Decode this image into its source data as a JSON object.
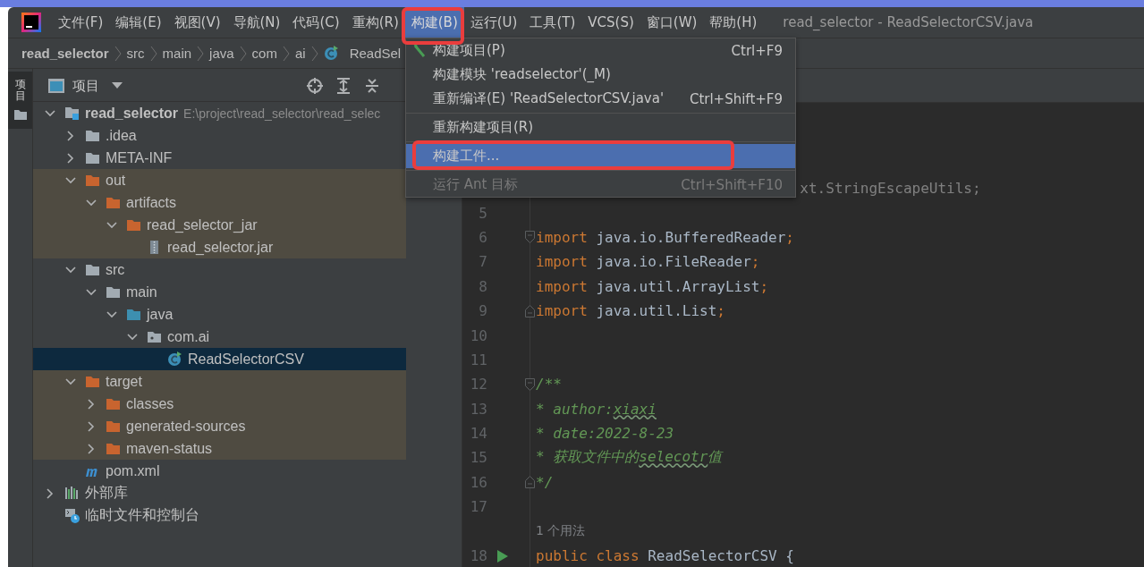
{
  "menubar": {
    "items": [
      {
        "label": "文件(F)",
        "selected": false,
        "annotated": false
      },
      {
        "label": "编辑(E)",
        "selected": false,
        "annotated": false
      },
      {
        "label": "视图(V)",
        "selected": false,
        "annotated": false
      },
      {
        "label": "导航(N)",
        "selected": false,
        "annotated": false
      },
      {
        "label": "代码(C)",
        "selected": false,
        "annotated": false
      },
      {
        "label": "重构(R)",
        "selected": false,
        "annotated": false
      },
      {
        "label": "构建(B)",
        "selected": true,
        "annotated": true
      },
      {
        "label": "运行(U)",
        "selected": false,
        "annotated": false
      },
      {
        "label": "工具(T)",
        "selected": false,
        "annotated": false
      },
      {
        "label": "VCS(S)",
        "selected": false,
        "annotated": false
      },
      {
        "label": "窗口(W)",
        "selected": false,
        "annotated": false
      },
      {
        "label": "帮助(H)",
        "selected": false,
        "annotated": false
      }
    ],
    "title": "read_selector - ReadSelectorCSV.java"
  },
  "breadcrumb": [
    {
      "label": "read_selector",
      "kind": "project"
    },
    {
      "label": "src",
      "kind": "folder"
    },
    {
      "label": "main",
      "kind": "folder"
    },
    {
      "label": "java",
      "kind": "folder"
    },
    {
      "label": "com",
      "kind": "folder"
    },
    {
      "label": "ai",
      "kind": "folder"
    },
    {
      "label": "ReadSel",
      "kind": "class"
    }
  ],
  "tool_strip": {
    "tabs": [
      {
        "label": "项目",
        "selected": true
      }
    ]
  },
  "project": {
    "title": "项目",
    "tree": [
      {
        "label": "read_selector",
        "path": "E:\\project\\read_selector\\read_selec",
        "kind": "module",
        "expanded": true,
        "children": [
          {
            "label": ".idea",
            "kind": "folder",
            "expanded": false
          },
          {
            "label": "META-INF",
            "kind": "folder",
            "expanded": false
          },
          {
            "label": "out",
            "kind": "excluded-folder",
            "excluded": true,
            "expanded": true,
            "children": [
              {
                "label": "artifacts",
                "kind": "excluded-folder",
                "excluded": true,
                "expanded": true,
                "children": [
                  {
                    "label": "read_selector_jar",
                    "kind": "excluded-folder",
                    "excluded": true,
                    "expanded": true,
                    "children": [
                      {
                        "label": "read_selector.jar",
                        "kind": "jar",
                        "excluded": true
                      }
                    ]
                  }
                ]
              }
            ]
          },
          {
            "label": "src",
            "kind": "folder",
            "expanded": true,
            "children": [
              {
                "label": "main",
                "kind": "folder",
                "expanded": true,
                "children": [
                  {
                    "label": "java",
                    "kind": "source-folder",
                    "expanded": true,
                    "children": [
                      {
                        "label": "com.ai",
                        "kind": "package",
                        "expanded": true,
                        "children": [
                          {
                            "label": "ReadSelectorCSV",
                            "kind": "class",
                            "selected": true
                          }
                        ]
                      }
                    ]
                  }
                ]
              }
            ]
          },
          {
            "label": "target",
            "kind": "excluded-folder",
            "excluded": true,
            "expanded": true,
            "children": [
              {
                "label": "classes",
                "kind": "excluded-folder",
                "excluded": true,
                "expanded": false
              },
              {
                "label": "generated-sources",
                "kind": "excluded-folder",
                "excluded": true,
                "expanded": false
              },
              {
                "label": "maven-status",
                "kind": "excluded-folder",
                "excluded": true,
                "expanded": false
              }
            ]
          },
          {
            "label": "pom.xml",
            "kind": "maven"
          }
        ]
      },
      {
        "label": "外部库",
        "kind": "library",
        "expanded": false
      },
      {
        "label": "临时文件和控制台",
        "kind": "scratch"
      }
    ]
  },
  "menu": {
    "items": [
      {
        "kind": "build",
        "label": "构建项目(P)",
        "shortcut": "Ctrl+F9",
        "selected": false,
        "disabled": false,
        "annotated": false
      },
      {
        "kind": "item",
        "label": "构建模块 'readselector'(_M)",
        "selected": false,
        "disabled": false,
        "annotated": false
      },
      {
        "kind": "item",
        "label": "重新编译(E) 'ReadSelectorCSV.java'",
        "shortcut": "Ctrl+Shift+F9",
        "selected": false,
        "disabled": false,
        "annotated": false
      },
      {
        "kind": "separator"
      },
      {
        "kind": "item",
        "label": "重新构建项目(R)",
        "selected": false,
        "disabled": false,
        "annotated": false
      },
      {
        "kind": "separator"
      },
      {
        "kind": "item",
        "label": "构建工件...",
        "selected": true,
        "disabled": false,
        "annotated": true
      },
      {
        "kind": "separator"
      },
      {
        "kind": "item",
        "label": "运行 Ant 目标",
        "shortcut": "Ctrl+Shift+F10",
        "selected": false,
        "disabled": true,
        "annotated": false
      }
    ]
  },
  "editor": {
    "lines": [
      {
        "kind": "partial",
        "segments": [
          {
            "text": "xt.StringEscapeUtils;",
            "kind": "comment"
          }
        ]
      },
      {
        "kind": "code",
        "number": "5"
      },
      {
        "kind": "code",
        "number": "6",
        "fold_start": true,
        "segments": [
          {
            "text": "import",
            "kind": "keyword"
          },
          {
            "text": " java.io.BufferedReader",
            "kind": "plain"
          },
          {
            "text": ";",
            "kind": "keyword"
          }
        ]
      },
      {
        "kind": "code",
        "number": "7",
        "segments": [
          {
            "text": "import",
            "kind": "keyword"
          },
          {
            "text": " java.io.FileReader",
            "kind": "plain"
          },
          {
            "text": ";",
            "kind": "keyword"
          }
        ]
      },
      {
        "kind": "code",
        "number": "8",
        "segments": [
          {
            "text": "import",
            "kind": "keyword"
          },
          {
            "text": " java.util.ArrayList",
            "kind": "plain"
          },
          {
            "text": ";",
            "kind": "keyword"
          }
        ]
      },
      {
        "kind": "code",
        "number": "9",
        "fold_end": true,
        "segments": [
          {
            "text": "import",
            "kind": "keyword"
          },
          {
            "text": " java.util.List",
            "kind": "plain"
          },
          {
            "text": ";",
            "kind": "keyword"
          }
        ]
      },
      {
        "kind": "code",
        "number": "10"
      },
      {
        "kind": "code",
        "number": "11"
      },
      {
        "kind": "code",
        "number": "12",
        "fold_start": true,
        "segments": [
          {
            "text": "/**",
            "kind": "doc"
          }
        ]
      },
      {
        "kind": "code",
        "number": "13",
        "segments": [
          {
            "text": " * author:",
            "kind": "doc"
          },
          {
            "text": "xiaxi",
            "kind": "typo"
          }
        ]
      },
      {
        "kind": "code",
        "number": "14",
        "segments": [
          {
            "text": " * date:2022-8-23",
            "kind": "doc"
          }
        ]
      },
      {
        "kind": "code",
        "number": "15",
        "segments": [
          {
            "text": " * 获取文件中的",
            "kind": "doc"
          },
          {
            "text": "selecotr",
            "kind": "typo"
          },
          {
            "text": "值",
            "kind": "doc"
          }
        ]
      },
      {
        "kind": "code",
        "number": "16",
        "fold_end": true,
        "segments": [
          {
            "text": " */",
            "kind": "doc"
          }
        ]
      },
      {
        "kind": "code",
        "number": "17"
      },
      {
        "kind": "inlay",
        "text": "1 个用法"
      },
      {
        "kind": "code",
        "number": "18",
        "run": true,
        "segments": [
          {
            "text": "public class",
            "kind": "keyword"
          },
          {
            "text": " ReadSelectorCSV {",
            "kind": "plain"
          }
        ]
      }
    ]
  }
}
